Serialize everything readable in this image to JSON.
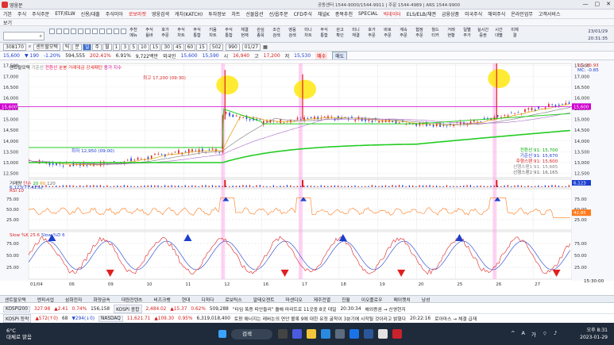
{
  "window": {
    "title": "영웅문",
    "header_info": "공동센터 1544-9000/1544-9911 | 주문 1544-4989 | ARS 1544-9900",
    "controls": [
      "—",
      "▢",
      "✕"
    ]
  },
  "menu": {
    "items": [
      "기본",
      "주식",
      "주식주문",
      "ETF/ELW",
      "신용/대출",
      "주식미아",
      "로보마켓",
      "영웅검색",
      "캐치(KATCH)",
      "투자정보",
      "차트",
      "선물옵션",
      "선/옵주문",
      "CFD주식",
      "채널K",
      "종목추천",
      "SPECIAL",
      "빅데이터",
      "ELS/ELB/채권",
      "금융상품",
      "미국주식",
      "해외주식",
      "온라인업무",
      "고객서비스"
    ],
    "highlighted": [
      "로보마켓",
      "빅데이터"
    ],
    "second_row": "보기"
  },
  "toolbar": {
    "search_value": "",
    "buttons": [
      {
        "top": "추천",
        "bottom": "메뉴"
      },
      {
        "top": "주식",
        "bottom": "틀바"
      },
      {
        "top": "호가",
        "bottom": "주문"
      },
      {
        "top": "주식",
        "bottom": "차트"
      },
      {
        "top": "주식",
        "bottom": "통합"
      },
      {
        "top": "키움",
        "bottom": "차트"
      },
      {
        "top": "주식",
        "bottom": "통합"
      },
      {
        "top": "체결",
        "bottom": "현재"
      },
      {
        "top": "관심",
        "bottom": "종목"
      },
      {
        "top": "조건",
        "bottom": "검색"
      },
      {
        "top": "영웅",
        "bottom": "검색"
      },
      {
        "top": "미니",
        "bottom": "차트"
      },
      {
        "top": "주식",
        "bottom": "통합"
      },
      {
        "top": "관고",
        "bottom": "확인"
      },
      {
        "top": "미니",
        "bottom": "체결"
      },
      {
        "top": "호가",
        "bottom": "주문"
      },
      {
        "top": "바로",
        "bottom": "주문"
      },
      {
        "top": "계속",
        "bottom": "주문"
      },
      {
        "top": "협정",
        "bottom": "주문"
      },
      {
        "top": "월드",
        "bottom": "티커"
      },
      {
        "top": "거래",
        "bottom": "현황"
      },
      {
        "top": "일별",
        "bottom": "주가"
      },
      {
        "top": "실시간",
        "bottom": "증권"
      },
      {
        "top": "시간",
        "bottom": "대별"
      },
      {
        "top": "미체",
        "bottom": "결"
      }
    ],
    "date": "23/01/29",
    "time": "20:31:35"
  },
  "controls": {
    "code": "308170",
    "name": "센트랄모텍",
    "periods": [
      "틱",
      "분",
      "일",
      "주",
      "월",
      "1",
      "3",
      "5",
      "10",
      "15",
      "30",
      "45",
      "60",
      "15"
    ],
    "selected_period": "일",
    "count": "502",
    "count2": "990",
    "date_value": "01/27"
  },
  "quote": {
    "price": "15,600",
    "change": "▼ 190",
    "pct": "-1.20%",
    "volume": "594,555",
    "vol_pct": "202.41%",
    "rate": "6.91%",
    "amount": "9,722백만",
    "label_high": "외국인",
    "p1": "15,600",
    "p2": "15,590",
    "high_label": "시",
    "open": "16,940",
    "high_label2": "고",
    "high": "17,200",
    "low_label": "저",
    "low": "15,530",
    "buy": "매수",
    "sell": "매도"
  },
  "chart_data": [
    {
      "type": "candlestick",
      "title": "센트랄모텍",
      "legend": [
        "기준선",
        "전환선",
        "이동식기준선",
        "이동평균선",
        "분봉 거래대금 강세패턴",
        "종가 지수"
      ],
      "annotation_high": "최고 17,200 (09:30)",
      "annotation_low": "최저 12,950 (09:00)",
      "ylim": [
        12300,
        17600
      ],
      "yticks": [
        17500,
        17000,
        16500,
        16000,
        15500,
        15000,
        14500,
        14000,
        13500,
        13000,
        12500
      ],
      "xlabels": [
        "01/04",
        "06",
        "09",
        "10",
        "11",
        "12",
        "16",
        "17",
        "18",
        "19",
        "20",
        "25",
        "26",
        "27"
      ],
      "current": 15600,
      "right_labels": [
        "전환선 91: 15,700",
        "기준선 91: 15,670",
        "후행스팬 91: 15,600",
        "선행스팬1 91: 15,685",
        "선행스팬2 91: 16,165"
      ],
      "spikes": [
        16800,
        16600,
        17100
      ],
      "lc_label": "LC: 20.93",
      "mc_label": "MC: -0.85"
    },
    {
      "type": "bar",
      "title": "거래량",
      "legend": [
        "단순",
        "20",
        "60",
        "120"
      ],
      "current": "6,123",
      "value2": "6,123(77.41%)"
    },
    {
      "type": "line",
      "title": "RSI 10",
      "ylim": [
        0,
        100
      ],
      "yticks": [
        75,
        50,
        25
      ],
      "current": "42.85"
    },
    {
      "type": "line",
      "title": "Slow %K",
      "legend": [
        "Slow %K 25.6",
        "Slow %D 6"
      ],
      "ylim": [
        0,
        100
      ],
      "yticks": [
        75,
        50,
        25
      ],
      "time_label": "15:30:00"
    }
  ],
  "bottom_tabs": [
    "센트랄모텍",
    "엔피서업",
    "삼화전자",
    "화양금속",
    "대원컨텐츠",
    "비즈크뱅",
    "현대",
    "디피다",
    "로보틱스",
    "알테오젠트",
    "마센디오",
    "제주전멸",
    "진월",
    "이오플로우",
    "메이켓치",
    "남성"
  ],
  "tickers": [
    {
      "label": "KOSPI200",
      "value": "327.98",
      "change": "▲2.41",
      "pct": "0.74%",
      "volume": "156,158",
      "label2": "KOSPI 종합",
      "v2": "2,484.02",
      "c2": "▲15.37",
      "p2": "0.62%",
      "vol2": "509,288",
      "news": "\"타임 폭증 따안들리\" 올해 마리트로 11곳중 8곳 대일",
      "time": "20:30:34",
      "extra": "해외증권 → 신영현지"
    },
    {
      "label": "KOSPI 등락",
      "value": "▲572(↑0)",
      "change": "68",
      "pct": "▼294(↓0)",
      "volume": "",
      "label2": "NASDAQ",
      "v2": "11,621.71",
      "c2": "▲109.30",
      "p2": "0.95%",
      "vol2": "6,319,018,400",
      "news": "토팡 에너지는 레바논의 연안 볼록 9에 대한 유정 굴착이 3분기에 시작될 것이라고 밝혔다",
      "time": "20:22:16",
      "extra": "로아마스 → 체결 급재"
    }
  ],
  "taskbar": {
    "temp": "6°C",
    "weather": "대체로 맑음",
    "search": "검색",
    "time": "오후 8:31",
    "date": "2023-01-29"
  }
}
